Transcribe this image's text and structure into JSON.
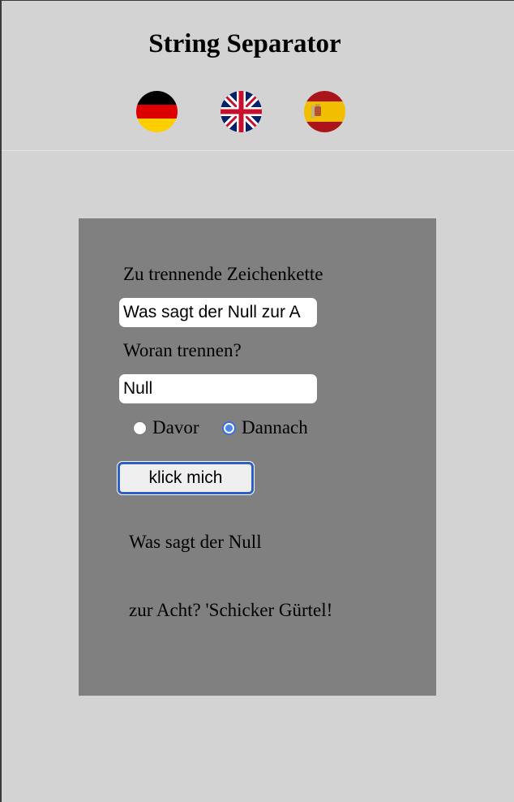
{
  "header": {
    "title": "String Separator",
    "languages": [
      {
        "name": "german-flag-icon",
        "code": "de"
      },
      {
        "name": "uk-flag-icon",
        "code": "en"
      },
      {
        "name": "spain-flag-icon",
        "code": "es"
      }
    ]
  },
  "form": {
    "string_label": "Zu trennende Zeichenkette",
    "string_value": "Was sagt der Null zur A",
    "separator_label": "Woran trennen?",
    "separator_value": "Null",
    "option_before": "Davor",
    "option_after": "Dannach",
    "selected_option": "Dannach",
    "button_label": "klick mich"
  },
  "result": {
    "part_1": "Was sagt der Null",
    "part_2": "zur Acht? 'Schicker Gürtel!"
  },
  "colors": {
    "page_background": "#d3d3d3",
    "panel_background": "#808080",
    "focus_ring": "#2d5fc7",
    "radio_selected": "#4a86f0"
  }
}
